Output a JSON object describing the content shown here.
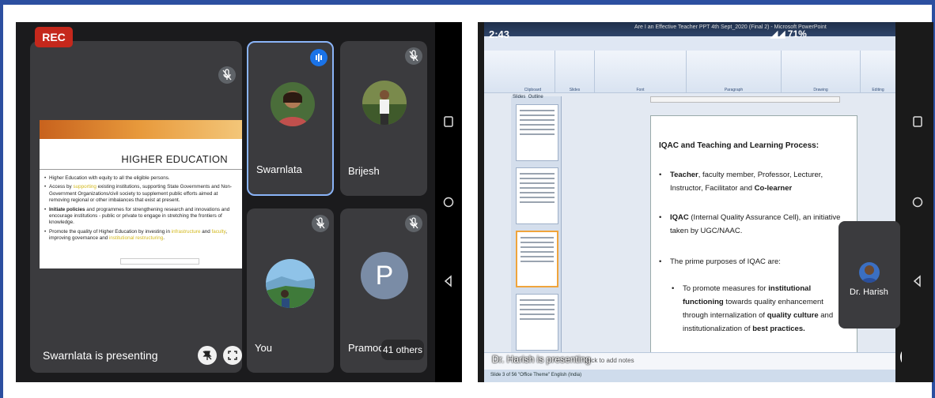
{
  "left": {
    "rec_label": "REC",
    "slide": {
      "title": "HIGHER EDUCATION",
      "bullets": [
        {
          "parts": [
            {
              "t": "Higher Education with equity to all the eligible persons.",
              "s": "n"
            }
          ]
        },
        {
          "parts": [
            {
              "t": "Access by ",
              "s": "n"
            },
            {
              "t": "supporting",
              "s": "h"
            },
            {
              "t": " existing institutions, supporting State Governments and Non-Government Organizations/civil society to supplement public efforts aimed at removing regional or other imbalances that exist at present.",
              "s": "n"
            }
          ]
        },
        {
          "parts": [
            {
              "t": "Initiate policies",
              "s": "b"
            },
            {
              "t": " and programmes for strengthening research and innovations and encourage institutions - public or private to engage in stretching the frontiers of knowledge.",
              "s": "n"
            }
          ]
        },
        {
          "parts": [
            {
              "t": "Promote the quality of Higher Education by investing in ",
              "s": "n"
            },
            {
              "t": "infrastructure",
              "s": "h"
            },
            {
              "t": " and ",
              "s": "n"
            },
            {
              "t": "faculty",
              "s": "h"
            },
            {
              "t": ", improving governance and ",
              "s": "n"
            },
            {
              "t": "institutional restructuring",
              "s": "h"
            },
            {
              "t": ".",
              "s": "n"
            }
          ]
        }
      ]
    },
    "presenting_text": "Swarnlata is presenting",
    "participants": [
      {
        "name": "Swarnlata"
      },
      {
        "name": "Brijesh"
      },
      {
        "name": "You"
      },
      {
        "name": "Pramod",
        "initial": "P"
      }
    ],
    "others_count": "41 others"
  },
  "right": {
    "status_time": "2:43",
    "status_battery": "71%",
    "ppt_window_title": "Are I an Effective Teacher PPT 4th Sept_2020 (Final 2) - Microsoft PowerPoint",
    "ribbon_groups": [
      "Clipboard",
      "Slides",
      "Font",
      "Paragraph",
      "Drawing",
      "Editing"
    ],
    "pane_tabs": [
      "Slides",
      "Outline"
    ],
    "slide_heading": "IQAC and Teaching and Learning Process:",
    "slide_b1_strong": "Teacher",
    "slide_b1_rest": ", faculty member, Professor, Lecturer, Instructor, Facilitator and ",
    "slide_b1_end": "Co-learner",
    "slide_b2_strong": "IQAC",
    "slide_b2_rest": " (Internal Quality Assurance Cell), an initiative taken by UGC/NAAC.",
    "slide_b3": "The prime purposes of IQAC are:",
    "slide_sub_a": "To promote measures for ",
    "slide_sub_b": "institutional functioning",
    "slide_sub_c": " towards quality enhancement through internalization of ",
    "slide_sub_d": "quality culture",
    "slide_sub_e": " and institutionalization of ",
    "slide_sub_f": "best practices.",
    "notes_placeholder": "Click to add notes",
    "presenting_text": "Dr. Harish is presenting",
    "status_bar": "Slide 3 of 56   \"Office Theme\"   English (India)",
    "float_name": "Dr. Harish"
  },
  "colors": {
    "frame": "#2c4fa0",
    "rec": "#c5281c",
    "speaking_border": "#8ab4f8",
    "highlight": "#d2b81c"
  }
}
